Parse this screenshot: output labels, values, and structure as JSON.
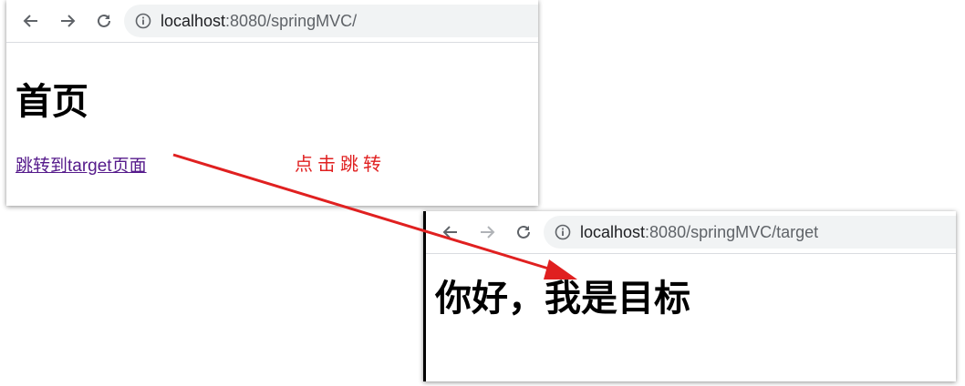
{
  "window1": {
    "address": {
      "host": "localhost",
      "path": ":8080/springMVC/"
    },
    "heading": "首页",
    "link_text": "跳转到target页面"
  },
  "window2": {
    "address": {
      "host": "localhost",
      "path": ":8080/springMVC/target"
    },
    "heading": "你好，我是目标"
  },
  "annotation": {
    "caption": "点击跳转",
    "color": "#e02020"
  }
}
